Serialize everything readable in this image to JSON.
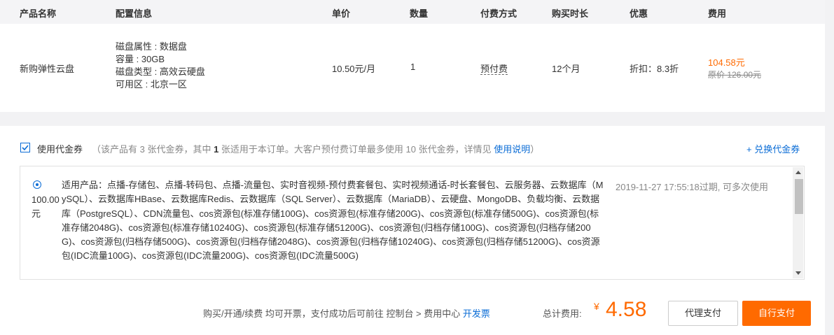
{
  "table": {
    "headers": [
      "产品名称",
      "配置信息",
      "单价",
      "数量",
      "付费方式",
      "购买时长",
      "优惠",
      "费用"
    ],
    "row": {
      "product": "新购弹性云盘",
      "config": [
        "磁盘属性 : 数据盘",
        "容量 : 30GB",
        "磁盘类型 : 高效云硬盘",
        "可用区 : 北京一区"
      ],
      "unit_price": "10.50元/月",
      "quantity": "1",
      "pay_mode": "预付费",
      "duration": "12个月",
      "discount": "折扣：8.3折",
      "cost": "104.58元",
      "original_cost": "原价 126.00元"
    }
  },
  "voucher": {
    "use_label": "使用代金券",
    "note_prefix": "（该产品有 3 张代金券，其中 ",
    "note_bold": "1",
    "note_suffix": " 张适用于本订单。大客户预付费订单最多使用 10 张代金券，详情见 ",
    "note_link": "使用说明",
    "note_end": "）",
    "redeem_link": "+ 兑换代金券",
    "item": {
      "amount_line1": "100.00",
      "amount_line2": "元",
      "applicable": "适用产品：点播-存储包、点播-转码包、点播-流量包、实时音视频-预付费套餐包、实时视频通话-时长套餐包、云服务器、云数据库（MySQL）、云数据库HBase、云数据库Redis、云数据库（SQL Server）、云数据库（MariaDB）、云硬盘、MongoDB、负载均衡、云数据库（PostgreSQL）、CDN流量包、cos资源包(标准存储100G)、cos资源包(标准存储200G)、cos资源包(标准存储500G)、cos资源包(标准存储2048G)、cos资源包(标准存储10240G)、cos资源包(标准存储51200G)、cos资源包(归档存储100G)、cos资源包(归档存储200G)、cos资源包(归档存储500G)、cos资源包(归档存储2048G)、cos资源包(归档存储10240G)、cos资源包(归档存储51200G)、cos资源包(IDC流量100G)、cos资源包(IDC流量200G)、cos资源包(IDC流量500G)",
      "expiry": "2019-11-27 17:55:18过期, 可多次使用"
    }
  },
  "footer": {
    "invoice_note": "购买/开通/续费 均可开票，支付成功后可前往 控制台 > 费用中心 ",
    "invoice_link": "开发票",
    "total_label": "总计费用:",
    "currency": "¥",
    "total": "4.58",
    "agent_pay": "代理支付",
    "self_pay": "自行支付"
  },
  "colors": {
    "accent": "#ff6a00",
    "link": "#0a6cd6"
  }
}
